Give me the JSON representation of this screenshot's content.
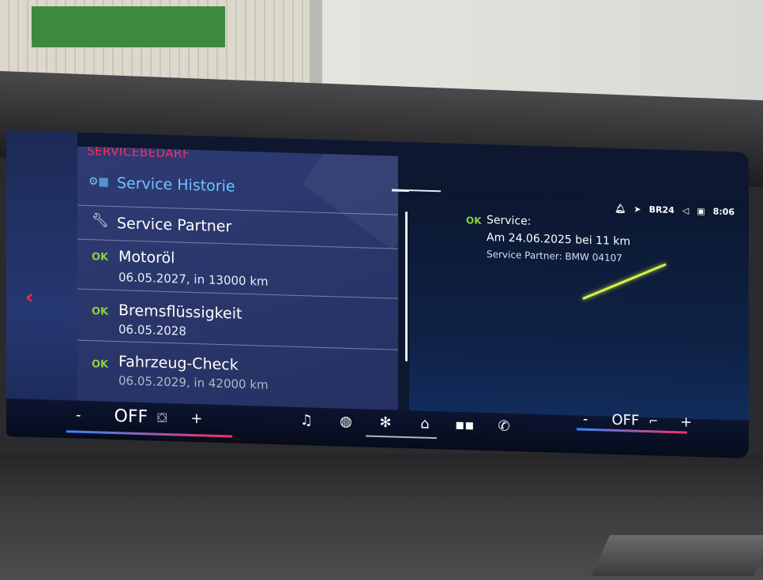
{
  "header": {
    "title": "SERVICEBEDARF"
  },
  "menu": {
    "items": [
      {
        "label": "Service Historie",
        "icon": "service-history-icon"
      },
      {
        "label": "Service Partner",
        "icon": "wrench-icon"
      }
    ]
  },
  "service_items": [
    {
      "status": "OK",
      "label": "Motoröl",
      "detail": "06.05.2027, in 13000 km"
    },
    {
      "status": "OK",
      "label": "Bremsflüssigkeit",
      "detail": "06.05.2028"
    },
    {
      "status": "OK",
      "label": "Fahrzeug-Check",
      "detail": "06.05.2029, in 42000 km"
    }
  ],
  "detail": {
    "status": "OK",
    "title": "Service:",
    "date_line": "Am 24.06.2025 bei 11 km",
    "partner_line": "Service Partner: BMW 04107"
  },
  "status_bar": {
    "radio": "BR24",
    "time": "8:06"
  },
  "climate_left": {
    "minus": "-",
    "value": "OFF",
    "plus": "+"
  },
  "climate_right": {
    "minus": "-",
    "value": "OFF",
    "plus": "+"
  },
  "colors": {
    "accent_red": "#ff2d5f",
    "ok_green": "#8ad33a",
    "highlight_blue": "#6fc3ff"
  },
  "nav": [
    "music-icon",
    "driving-icon",
    "fan-icon",
    "home-icon",
    "apps-icon",
    "phone-icon"
  ]
}
